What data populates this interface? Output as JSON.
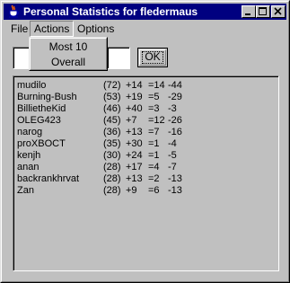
{
  "window": {
    "title": "Personal Statistics for fledermaus",
    "icon": "java-cup-icon",
    "controls": [
      "minimize-icon",
      "maximize-icon",
      "close-icon"
    ]
  },
  "menubar": {
    "items": [
      "File",
      "Actions",
      "Options"
    ],
    "active": "Actions"
  },
  "actions_menu": {
    "items": [
      "Most 10",
      "Overall"
    ]
  },
  "form": {
    "left_input_value": "",
    "right_input_value": "",
    "ok_label": "OK"
  },
  "stats": [
    {
      "name": "mudilo",
      "total": "(72)",
      "wins": "+14",
      "draws": "=14",
      "losses": "-44"
    },
    {
      "name": "Burning-Bush",
      "total": "(53)",
      "wins": "+19",
      "draws": "=5",
      "losses": "-29"
    },
    {
      "name": "BillietheKid",
      "total": "(46)",
      "wins": "+40",
      "draws": "=3",
      "losses": "-3"
    },
    {
      "name": "OLEG423",
      "total": "(45)",
      "wins": "+7",
      "draws": "=12",
      "losses": "-26"
    },
    {
      "name": "narog",
      "total": "(36)",
      "wins": "+13",
      "draws": "=7",
      "losses": "-16"
    },
    {
      "name": "proXBOCT",
      "total": "(35)",
      "wins": "+30",
      "draws": "=1",
      "losses": "-4"
    },
    {
      "name": "kenjh",
      "total": "(30)",
      "wins": "+24",
      "draws": "=1",
      "losses": "-5"
    },
    {
      "name": "anan",
      "total": "(28)",
      "wins": "+17",
      "draws": "=4",
      "losses": "-7"
    },
    {
      "name": "backrankhrvat",
      "total": "(28)",
      "wins": "+13",
      "draws": "=2",
      "losses": "-13"
    },
    {
      "name": "Zan",
      "total": "(28)",
      "wins": "+9",
      "draws": "=6",
      "losses": "-13"
    }
  ]
}
